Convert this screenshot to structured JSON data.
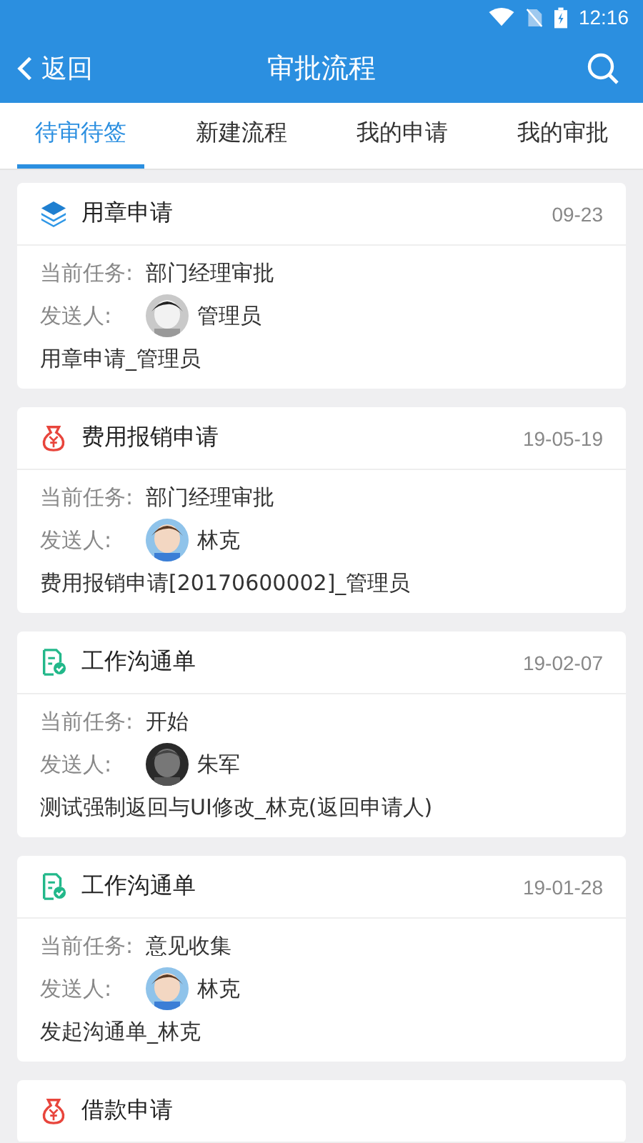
{
  "status_bar": {
    "time": "12:16"
  },
  "app_bar": {
    "back": "返回",
    "title": "审批流程"
  },
  "tabs": [
    {
      "label": "待审待签",
      "selected": true
    },
    {
      "label": "新建流程",
      "selected": false
    },
    {
      "label": "我的申请",
      "selected": false
    },
    {
      "label": "我的审批",
      "selected": false
    }
  ],
  "cards": [
    {
      "kind": "layers",
      "title": "用章申请",
      "date": "09-23",
      "task_label": "当前任务:",
      "task": "部门经理审批",
      "sender_label": "发送人:",
      "sender": "管理员",
      "summary": "用章申请_管理员"
    },
    {
      "kind": "money",
      "title": "费用报销申请",
      "date": "19-05-19",
      "task_label": "当前任务:",
      "task": "部门经理审批",
      "sender_label": "发送人:",
      "sender": "林克",
      "summary": "费用报销申请[20170600002]_管理员"
    },
    {
      "kind": "document",
      "title": "工作沟通单",
      "date": "19-02-07",
      "task_label": "当前任务:",
      "task": "开始",
      "sender_label": "发送人:",
      "sender": "朱军",
      "summary": "测试强制返回与UI修改_林克(返回申请人)"
    },
    {
      "kind": "document",
      "title": "工作沟通单",
      "date": "19-01-28",
      "task_label": "当前任务:",
      "task": "意见收集",
      "sender_label": "发送人:",
      "sender": "林克",
      "summary": "发起沟通单_林克"
    },
    {
      "kind": "money",
      "title": "借款申请"
    }
  ]
}
